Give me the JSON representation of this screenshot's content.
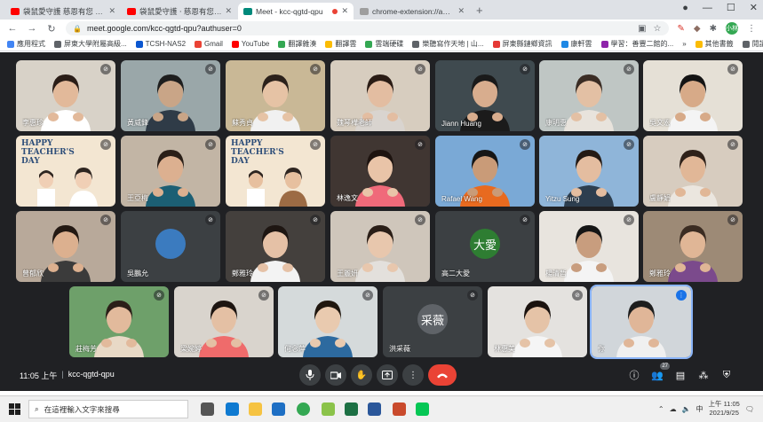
{
  "browser": {
    "tabs": [
      {
        "title": "袋鼠愛守護 慈恩有您 - YouTube",
        "active": false,
        "favicon_color": "#ff0000",
        "recording": false
      },
      {
        "title": "袋鼠愛守護 ‧ 慈恩有您 - YouTu",
        "active": false,
        "favicon_color": "#ff0000",
        "recording": false
      },
      {
        "title": "Meet - kcc-qgtd-qpu",
        "active": true,
        "favicon_color": "#00897b",
        "recording": true
      },
      {
        "title": "chrome-extension://appcnhiefc",
        "active": false,
        "favicon_color": "#9e9e9e",
        "recording": false
      }
    ],
    "new_tab_label": "+",
    "url": "meet.google.com/kcc-qgtd-qpu?authuser=0",
    "profile_initial": "小林",
    "bookmarks": [
      {
        "label": "應用程式",
        "color": "#4285f4"
      },
      {
        "label": "屏東大學附屬高級...",
        "color": "#5f6368"
      },
      {
        "label": "TCSH-NAS2",
        "color": "#0b57d0"
      },
      {
        "label": "Gmail",
        "color": "#ea4335"
      },
      {
        "label": "YouTube",
        "color": "#ff0000"
      },
      {
        "label": "翻譯雜湊",
        "color": "#34a853"
      },
      {
        "label": "翻譯雲",
        "color": "#fbbc04"
      },
      {
        "label": "雲端硬碟",
        "color": "#34a853"
      },
      {
        "label": "樂聽寫作天地 | 山...",
        "color": "#5f6368"
      },
      {
        "label": "屏東縣鏈鄉資訊",
        "color": "#e53935"
      },
      {
        "label": "康軒雲",
        "color": "#1e88e5"
      },
      {
        "label": "學習：善豐二館的...",
        "color": "#8e24aa"
      },
      {
        "label": "其他書籤",
        "color": "#fbbc04"
      },
      {
        "label": "閱讀清單",
        "color": "#5f6368"
      }
    ],
    "more_bookmarks": "»"
  },
  "meet": {
    "participants": [
      {
        "name": "李惠珍",
        "kind": "video",
        "bg": "#d8d2c8",
        "skin": "#e2b99a",
        "hair": "#2a1d17",
        "shirt": "#ffffff",
        "muted": true,
        "speaking": false
      },
      {
        "name": "黃威鋒",
        "kind": "video",
        "bg": "#9aa7a9",
        "skin": "#c9a587",
        "hair": "#1e1e1e",
        "shirt": "#2f3b47",
        "muted": true,
        "speaking": false
      },
      {
        "name": "蘇秀貞",
        "kind": "video",
        "bg": "#c9b896",
        "skin": "#e6c3a5",
        "hair": "#2b211b",
        "shirt": "#f1f1f1",
        "muted": true,
        "speaking": false
      },
      {
        "name": "魏琴樺老師",
        "kind": "video",
        "bg": "#d7cdbf",
        "skin": "#e3bda1",
        "hair": "#2a1c15",
        "shirt": "#d9d4cf",
        "muted": true,
        "speaking": false
      },
      {
        "name": "Jiann Huang",
        "kind": "video",
        "bg": "#3f4a4f",
        "skin": "#d8ad8e",
        "hair": "#1a1a1a",
        "shirt": "#1b1b1b",
        "muted": true,
        "speaking": false
      },
      {
        "name": "康明惠",
        "kind": "video",
        "bg": "#bfc6c4",
        "skin": "#e3c0a4",
        "hair": "#3a2c24",
        "shirt": "#e8e3dc",
        "muted": true,
        "speaking": false
      },
      {
        "name": "吳文宏",
        "kind": "video",
        "bg": "#e5e0d6",
        "skin": "#d7aa88",
        "hair": "#141414",
        "shirt": "#f4f4f4",
        "muted": true,
        "speaking": false
      },
      {
        "name": "",
        "kind": "poster",
        "bg": "#f3e6d2",
        "skin": "#f0cfb5",
        "hair": "#2e2520",
        "shirt": "#ffffff",
        "poster_text": "HAPPY TEACHER'S DAY",
        "muted": true,
        "speaking": false
      },
      {
        "name": "王亞梅",
        "kind": "video",
        "bg": "#c2b5a5",
        "skin": "#dcb090",
        "hair": "#2a1f18",
        "shirt": "#1c5f74",
        "muted": true,
        "speaking": false
      },
      {
        "name": "",
        "kind": "poster",
        "bg": "#f3e6d2",
        "skin": "#e7c09f",
        "hair": "#2e2520",
        "shirt": "#9c6b44",
        "poster_text": "HAPPY TEACHER'S DAY",
        "muted": true,
        "speaking": false
      },
      {
        "name": "林逸文",
        "kind": "video",
        "bg": "#403632",
        "skin": "#e9c4a8",
        "hair": "#1d130f",
        "shirt": "#f06a7a",
        "muted": true,
        "speaking": false
      },
      {
        "name": "Rafael Wang",
        "kind": "video",
        "bg": "#7aa9d6",
        "skin": "#c99b78",
        "hair": "#161616",
        "shirt": "#e86a1f",
        "muted": true,
        "speaking": false
      },
      {
        "name": "Yitzu Sung",
        "kind": "video",
        "bg": "#8fb5d9",
        "skin": "#e4bda0",
        "hair": "#241a14",
        "shirt": "#2d3e4f",
        "muted": true,
        "speaking": false
      },
      {
        "name": "盧靜娟",
        "kind": "video",
        "bg": "#d7ccbf",
        "skin": "#e1b797",
        "hair": "#2f2119",
        "shirt": "#ebe6df",
        "muted": true,
        "speaking": false
      },
      {
        "name": "曾郁欣",
        "kind": "video",
        "bg": "#b8a99a",
        "skin": "#dcb08f",
        "hair": "#231913",
        "shirt": "#3b3b3b",
        "muted": true,
        "speaking": false
      },
      {
        "name": "吳鵬允",
        "kind": "avatar",
        "bg": "#3c4043",
        "avatar_color": "#3b7bbf",
        "initial": "",
        "muted": true,
        "speaking": false
      },
      {
        "name": "鄭雅玲",
        "kind": "video",
        "bg": "#44403d",
        "skin": "#e5c1a6",
        "hair": "#1e1612",
        "shirt": "#f3f3f3",
        "muted": true,
        "speaking": false
      },
      {
        "name": "王麗妍",
        "kind": "video",
        "bg": "#cfc6bb",
        "skin": "#e8c7ad",
        "hair": "#2a1e17",
        "shirt": "#e3e0dc",
        "muted": true,
        "speaking": false
      },
      {
        "name": "高二大愛",
        "kind": "avatar",
        "bg": "#3c4043",
        "avatar_color": "#2e7d32",
        "initial": "大愛",
        "muted": true,
        "speaking": false
      },
      {
        "name": "楊清哲",
        "kind": "video",
        "bg": "#e8e4de",
        "skin": "#c89d7e",
        "hair": "#151515",
        "shirt": "#f4f4f4",
        "muted": true,
        "speaking": false
      },
      {
        "name": "鄭雅玲",
        "kind": "video",
        "bg": "#9d8a76",
        "skin": "#e0b696",
        "hair": "#3b2c22",
        "shirt": "#7b4a8c",
        "muted": true,
        "speaking": false
      },
      {
        "name": "莊梅芳",
        "kind": "video",
        "bg": "#6ea06a",
        "skin": "#e2ba9c",
        "hair": "#2b1f18",
        "shirt": "#e8d9c6",
        "muted": true,
        "speaking": false
      },
      {
        "name": "梁婉婷",
        "kind": "video",
        "bg": "#d9d4cd",
        "skin": "#e4c0a4",
        "hair": "#1d1511",
        "shirt": "#ef6b6b",
        "muted": true,
        "speaking": false
      },
      {
        "name": "何念萍",
        "kind": "video",
        "bg": "#d5dadb",
        "skin": "#e9caaf",
        "hair": "#20170f",
        "shirt": "#2d6a9f",
        "muted": true,
        "speaking": false
      },
      {
        "name": "洪采薇",
        "kind": "avatar",
        "bg": "#3c4043",
        "avatar_color": "#5f6368",
        "initial": "采薇",
        "muted": true,
        "speaking": false
      },
      {
        "name": "林惠美",
        "kind": "video",
        "bg": "#e4e2df",
        "skin": "#e5c3a7",
        "hair": "#1b130f",
        "shirt": "#f5f5f5",
        "muted": true,
        "speaking": false
      },
      {
        "name": "你",
        "kind": "video",
        "bg": "#d1d6da",
        "skin": "#e0b698",
        "hair": "#1e1e1e",
        "shirt": "#f0f0f0",
        "muted": false,
        "speaking": true
      }
    ],
    "meeting_time": "11:05 上午",
    "meeting_code": "kcc-qgtd-qpu",
    "separator": "|",
    "controls": {
      "mic_icon": "mic-icon",
      "camera_icon": "camera-icon",
      "raise_hand_icon": "hand-icon",
      "present_icon": "present-icon",
      "more_icon": "more-icon",
      "hangup_icon": "hangup-icon"
    },
    "participant_count": "27",
    "right_icons": [
      "info-icon",
      "people-icon",
      "chat-icon",
      "activities-icon",
      "security-icon"
    ]
  },
  "taskbar": {
    "search_placeholder": "在這裡輸入文字來搜尋",
    "apps": [
      {
        "name": "task-view",
        "color": "#555555"
      },
      {
        "name": "edge",
        "color": "#0f7ad1"
      },
      {
        "name": "file-explorer",
        "color": "#f6c342"
      },
      {
        "name": "mail",
        "color": "#1e6fc4"
      },
      {
        "name": "chrome",
        "color": "#34a853"
      },
      {
        "name": "add-app",
        "color": "#8bc34a"
      },
      {
        "name": "excel",
        "color": "#1d7044"
      },
      {
        "name": "word",
        "color": "#2b579a"
      },
      {
        "name": "powerpoint",
        "color": "#c94a2c"
      },
      {
        "name": "line",
        "color": "#06c755"
      }
    ],
    "clock_time": "上午 11:05",
    "clock_date": "2021/9/25"
  }
}
